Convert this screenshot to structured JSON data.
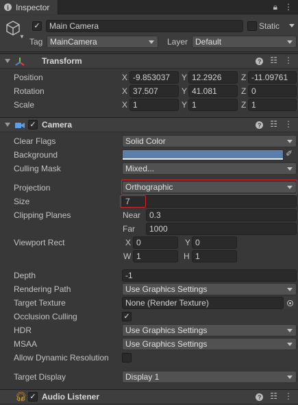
{
  "tab": {
    "title": "Inspector"
  },
  "object": {
    "name": "Main Camera",
    "static_label": "Static",
    "tag_label": "Tag",
    "tag_value": "MainCamera",
    "layer_label": "Layer",
    "layer_value": "Default"
  },
  "transform": {
    "title": "Transform",
    "rows": [
      {
        "label": "Position",
        "x": "-9.853037",
        "y": "12.2926",
        "z": "-11.09761"
      },
      {
        "label": "Rotation",
        "x": "37.507",
        "y": "41.081",
        "z": "0"
      },
      {
        "label": "Scale",
        "x": "1",
        "y": "1",
        "z": "1"
      }
    ]
  },
  "axes": {
    "x": "X",
    "y": "Y",
    "z": "Z",
    "w": "W",
    "h": "H"
  },
  "camera": {
    "title": "Camera",
    "clear_flags_label": "Clear Flags",
    "clear_flags_value": "Solid Color",
    "background_label": "Background",
    "background_color": "#5b7eab",
    "culling_mask_label": "Culling Mask",
    "culling_mask_value": "Mixed...",
    "projection_label": "Projection",
    "projection_value": "Orthographic",
    "size_label": "Size",
    "size_value": "7",
    "clipping_label": "Clipping Planes",
    "near_label": "Near",
    "near_value": "0.3",
    "far_label": "Far",
    "far_value": "1000",
    "viewport_label": "Viewport Rect",
    "viewport": {
      "x": "0",
      "y": "0",
      "w": "1",
      "h": "1"
    },
    "depth_label": "Depth",
    "depth_value": "-1",
    "rendering_path_label": "Rendering Path",
    "rendering_path_value": "Use Graphics Settings",
    "target_texture_label": "Target Texture",
    "target_texture_value": "None (Render Texture)",
    "occlusion_label": "Occlusion Culling",
    "occlusion_checked": true,
    "hdr_label": "HDR",
    "hdr_value": "Use Graphics Settings",
    "msaa_label": "MSAA",
    "msaa_value": "Use Graphics Settings",
    "dynamic_res_label": "Allow Dynamic Resolution",
    "dynamic_res_checked": false,
    "target_display_label": "Target Display",
    "target_display_value": "Display 1"
  },
  "audio_listener": {
    "title": "Audio Listener"
  },
  "colors": {
    "highlight": "#d9242b",
    "background_swatch": "#5b7eab",
    "panel": "#383838"
  }
}
